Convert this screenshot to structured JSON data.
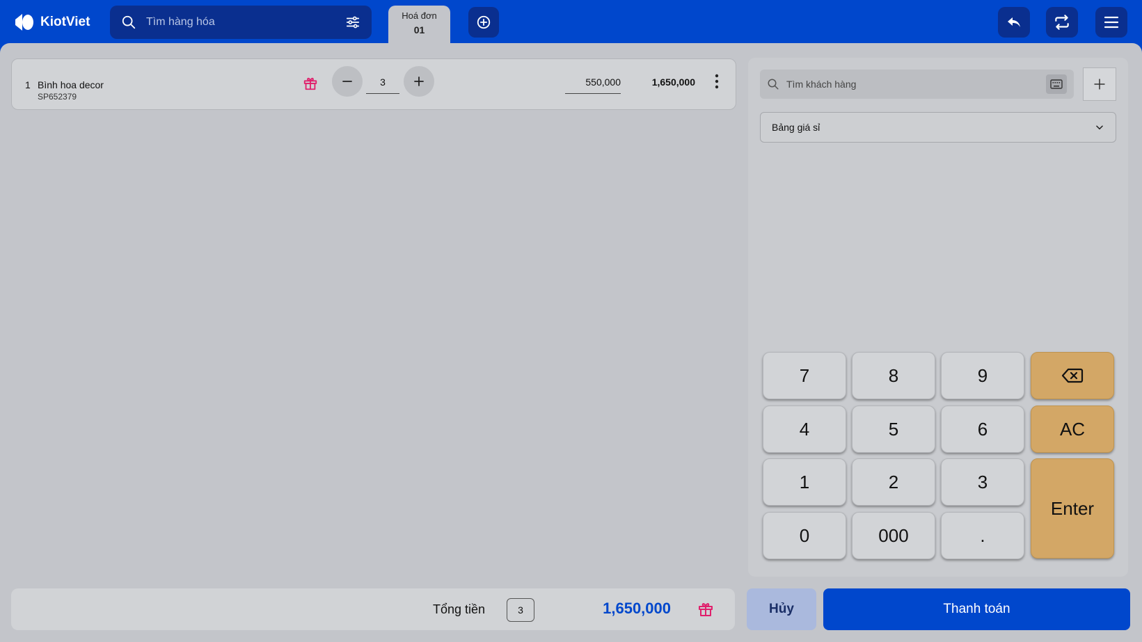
{
  "app": {
    "name": "KiotViet"
  },
  "search": {
    "placeholder": "Tìm hàng hóa"
  },
  "tabs": [
    {
      "label": "Hoá đơn",
      "number": "01",
      "active": true
    }
  ],
  "cart": {
    "items": [
      {
        "index": "1",
        "name": "Bình hoa decor",
        "code": "SP652379",
        "quantity": "3",
        "unit_price": "550,000",
        "line_total": "1,650,000"
      }
    ]
  },
  "customer": {
    "search_placeholder": "Tìm khách hàng"
  },
  "price_list": {
    "selected": "Bảng giá sỉ"
  },
  "keypad": {
    "keys": [
      "7",
      "8",
      "9",
      "4",
      "5",
      "6",
      "AC",
      "1",
      "2",
      "3",
      "Enter",
      "0",
      "000",
      "."
    ]
  },
  "summary": {
    "label": "Tổng tiền",
    "count": "3",
    "total": "1,650,000"
  },
  "actions": {
    "cancel": "Hủy",
    "pay": "Thanh toán"
  },
  "colors": {
    "brand": "#0047cc",
    "accent_key": "#d3a766",
    "gift": "#e0206c"
  }
}
